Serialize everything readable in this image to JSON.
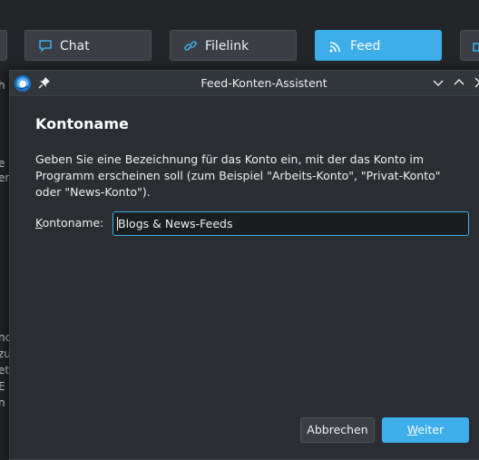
{
  "background": {
    "toolbar": {
      "chat_label": "Chat",
      "filelink_label": "Filelink",
      "feed_label": "Feed"
    },
    "side_fragments": [
      {
        "text": "h"
      },
      {
        "text": "e"
      },
      {
        "text": "er"
      },
      {
        "text": "nc"
      },
      {
        "text": "zu"
      },
      {
        "text": "et"
      },
      {
        "text": "nd"
      },
      {
        "text": "E"
      },
      {
        "text": "n"
      }
    ]
  },
  "dialog": {
    "title": "Feed-Konten-Assistent",
    "heading": "Kontoname",
    "description": "Geben Sie eine Bezeichnung für das Konto ein, mit der das Konto im Programm erscheinen soll (zum Beispiel \"Arbeits-Konto\", \"Privat-Konto\" oder \"News-Konto\").",
    "field": {
      "label_first": "K",
      "label_rest": "ontoname:",
      "value": "Blogs & News-Feeds"
    },
    "buttons": {
      "cancel_label": "Abbrechen",
      "next_first": "W",
      "next_rest": "eiter"
    }
  },
  "colors": {
    "accent": "#3daee9",
    "window_bg": "#2a2e32",
    "titlebar_bg": "#31363b",
    "text": "#eff0f1"
  },
  "icons": {
    "chat": "chat-bubble-icon",
    "filelink": "link-icon",
    "feed": "rss-icon",
    "partial_right": "contacts-icon",
    "app": "thunderbird-icon",
    "pin": "pin-icon",
    "minimize": "chevron-down-icon",
    "maximize": "chevron-up-icon",
    "close": "close-icon"
  }
}
